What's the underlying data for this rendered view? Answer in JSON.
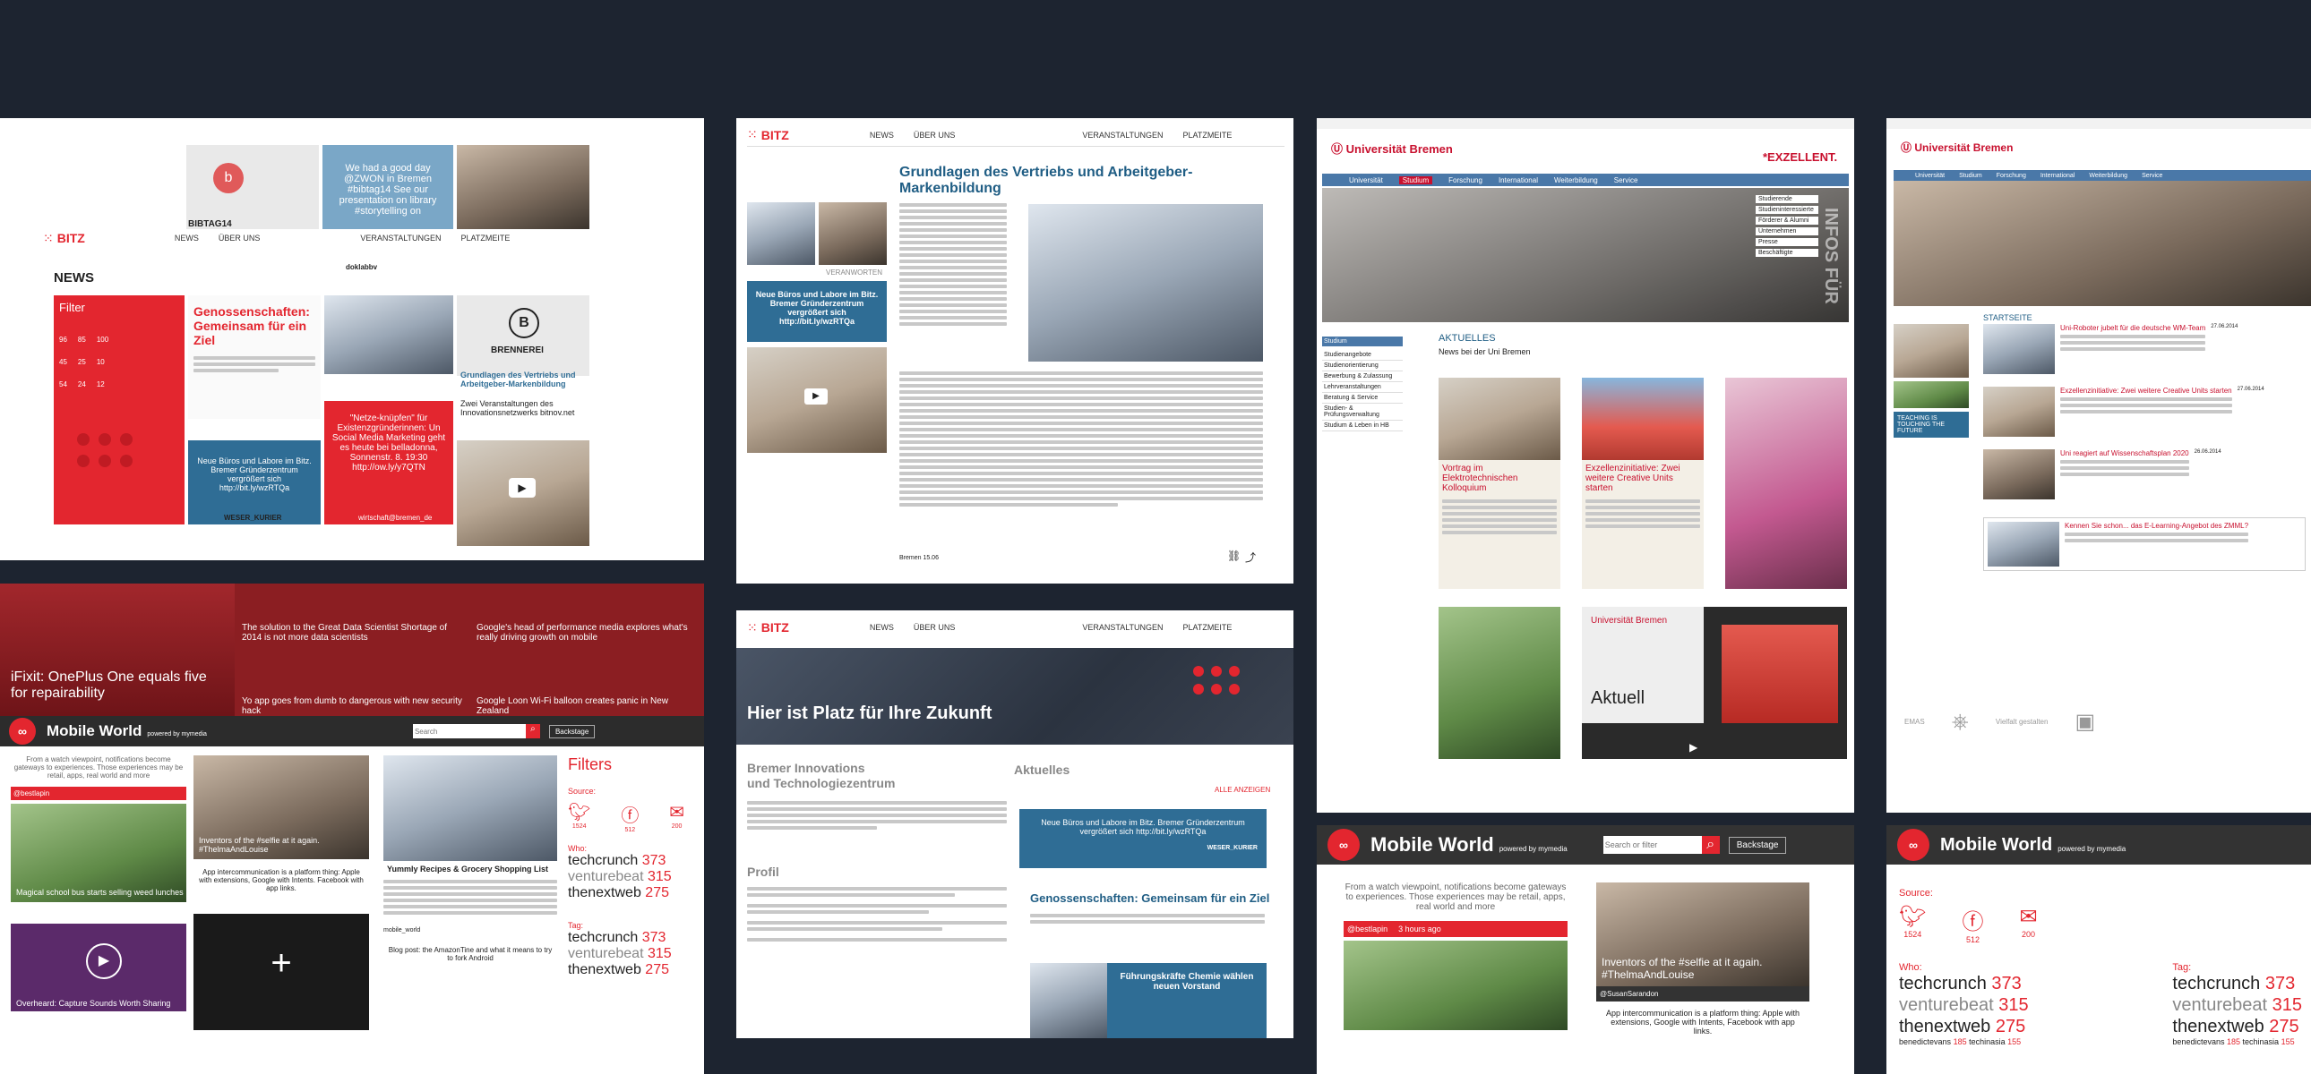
{
  "colors": {
    "background": "#1d2430",
    "accent_red": "#e3262f",
    "twitter_blue": "#2f6d95",
    "uni_red": "#c8102e"
  },
  "bitz_news": {
    "logo_text": "BITZ",
    "nav": [
      "NEWS",
      "ÜBER UNS",
      "VERANSTALTUNGEN",
      "PLATZMEITE"
    ],
    "page_title": "NEWS",
    "filter_title": "Filter",
    "filter_stats": [
      "96",
      "85",
      "100",
      "45",
      "25",
      "10",
      "54",
      "24",
      "12"
    ],
    "cards": {
      "genossenschaften": "Genossenschaften: Gemeinsam für ein Ziel",
      "gruendlagen": "Grundlagen des Vertriebs und Arbeitgeber-Markenbildung",
      "netze": "\"Netze-knüpfen\" für Existenzgründerinnen: Un Social Media Marketing geht es heute bei belladonna, Sonnenstr. 8. 19:30 http://ow.ly/y7QTN",
      "neue_buero": "Neue Büros und Labore im Bitz. Bremer Gründerzentrum vergrößert sich http://bit.ly/wzRTQa",
      "weser": "WESER_KURIER",
      "wirtschaft": "wirtschaft@bremen_de",
      "veranstaltungen": "Zwei Veranstaltungen des Innovationsnetzwerks bitnov.net",
      "bibtag": "BIBTAG14",
      "tweet_top": "We had a good day @ZWON in Bremen #bibtag14 See our presentation on library #storytelling on",
      "doklabbv": "doklabbv",
      "brennerei": "BRENNEREI"
    }
  },
  "bitz_article": {
    "nav": [
      "NEWS",
      "ÜBER UNS",
      "VERANSTALTUNGEN",
      "PLATZMEITE"
    ],
    "title": "Grundlagen des Vertriebs und Arbeitgeber-Markenbildung",
    "side_label": "VERANWORTEN",
    "side_tweet": "Neue Büros und Labore im Bitz. Bremer Gründerzentrum vergrößert sich http://bit.ly/wzRTQa",
    "footer": "Bremen 15.06"
  },
  "bitz_home": {
    "nav": [
      "NEWS",
      "ÜBER UNS",
      "VERANSTALTUNGEN",
      "PLATZMEITE"
    ],
    "hero": "Hier ist Platz für Ihre Zukunft",
    "org_title_1": "Bremer Innovations",
    "org_title_2": "und Technologiezentrum",
    "aktuelles": "Aktuelles",
    "alle_anzeigen": "ALLE ANZEIGEN",
    "profil": "Profil",
    "tweet": "Neue Büros und Labore im Bitz. Bremer Gründerzentrum vergrößert sich http://bit.ly/wzRTQa",
    "weser": "WESER_KURIER",
    "genossenschaften": "Genossenschaften: Gemeinsam für ein Ziel",
    "fuehrung": "Führungskräfte Chemie wählen neuen Vorstand"
  },
  "uni_left": {
    "logo": "Universität Bremen",
    "excellent": "*EXZELLENT.",
    "nav": [
      "Universität",
      "Studium",
      "Forschung",
      "International",
      "Weiterbildung",
      "Service"
    ],
    "side_menu": [
      "Studierende",
      "Studieninteressierte",
      "Förderer & Alumni",
      "Unternehmen",
      "Presse",
      "Beschäftigte"
    ],
    "vert_text": "INFOS FÜR",
    "aktuelles": "AKTUELLES",
    "news_sub": "News bei der Uni Bremen",
    "left_menu": [
      "Studium",
      "Studienangebote",
      "Studienorientierung",
      "Bewerbung & Zulassung",
      "Lehrveranstaltungen",
      "Beratung & Service",
      "Studien- & Prüfungsverwaltung",
      "Studium & Leben in HB"
    ],
    "card1": "Vortrag im Elektrotechnischen Kolloquium",
    "card2": "Exzellenzinitiative: Zwei weitere Creative Units starten",
    "aktuell": "Aktuell",
    "uni_small": "Universität Bremen"
  },
  "uni_right": {
    "logo": "Universität Bremen",
    "startseite": "STARTSEITE",
    "news": [
      "Uni-Roboter jubelt für die deutsche WM-Team",
      "Exzellenzinitiative: Zwei weitere Creative Units starten",
      "Uni reagiert auf Wissenschaftsplan 2020",
      "Kennen Sie schon... das E-Learning-Angebot des ZMML?"
    ],
    "nav": [
      "Universität",
      "Studium",
      "Forschung",
      "International",
      "Weiterbildung",
      "Service"
    ],
    "teaching": "TEACHING IS TOUCHING THE FUTURE",
    "emas": "EMAS",
    "vielfalt": "Vielfalt gestalten",
    "dates": [
      "27.06.2014",
      "27.06.2014",
      "26.06.2014"
    ]
  },
  "ifixit_strip": {
    "main": "iFixit: OnePlus One equals five for repairability",
    "items": [
      "The solution to the Great Data Scientist Shortage of 2014 is not more data scientists",
      "Google's head of performance media explores what's really driving growth on mobile",
      "Yo app goes from dumb to dangerous with new security hack",
      "Google Loon Wi-Fi balloon creates panic in New Zealand"
    ]
  },
  "mobile_world_big": {
    "title": "Mobile World",
    "powered": "powered by mymedia",
    "search_placeholder": "Search",
    "backstage": "Backstage",
    "filters": "Filters",
    "source": "Source:",
    "source_counts": [
      "1524",
      "512",
      "200"
    ],
    "who": "Who:",
    "who_list": [
      {
        "name": "techcrunch",
        "count": "373"
      },
      {
        "name": "venturebeat",
        "count": "315"
      },
      {
        "name": "thenextweb",
        "count": "275"
      }
    ],
    "tag": "Tag:",
    "tag_list": [
      {
        "name": "techcrunch",
        "count": "373"
      },
      {
        "name": "venturebeat",
        "count": "315"
      },
      {
        "name": "thenextweb",
        "count": "275"
      }
    ],
    "post1": "From a watch viewpoint, notifications become gateways to experiences. Those experiences may be retail, apps, real world and more",
    "post2": "Magical school bus starts selling weed lunches",
    "post3": "Inventors of the #selfie at it again. #ThelmaAndLouise",
    "post4": "App intercommunication is a platform thing: Apple with extensions, Google with Intents. Facebook with app links.",
    "post5": "Yummly Recipes & Grocery Shopping List",
    "post6": "Overheard: Capture Sounds Worth Sharing",
    "post7": "Blog post: the AmazonTine and what it means to try to fork Android",
    "handle": "@bestlapin",
    "mobile_world_handle": "mobile_world"
  },
  "mobile_world_mid": {
    "title": "Mobile World",
    "powered": "powered by mymedia",
    "search_placeholder": "Search or filter",
    "backstage": "Backstage",
    "post1": "From a watch viewpoint, notifications become gateways to experiences. Those experiences may be retail, apps, real world and more",
    "post2": "Inventors of the #selfie at it again. #ThelmaAndLouise",
    "post3": "App intercommunication is a platform thing: Apple with extensions, Google with Intents, Facebook with app links.",
    "handle": "@bestlapin",
    "handle2": "@SusanSarandon",
    "time": "3 hours ago"
  },
  "mobile_world_right": {
    "title": "Mobile World",
    "powered": "powered by mymedia",
    "source": "Source:",
    "source_counts": [
      "1524",
      "512",
      "200"
    ],
    "who": "Who:",
    "tag": "Tag:",
    "who_list": [
      {
        "name": "techcrunch",
        "count": "373"
      },
      {
        "name": "venturebeat",
        "count": "315"
      },
      {
        "name": "thenextweb",
        "count": "275"
      }
    ],
    "tag_list": [
      {
        "name": "techcrunch",
        "count": "373"
      },
      {
        "name": "venturebeat",
        "count": "315"
      },
      {
        "name": "thenextweb",
        "count": "275"
      }
    ],
    "small_a": "benedictevans",
    "small_a_count": "185",
    "small_b": "techinasia",
    "small_b_count": "155"
  }
}
